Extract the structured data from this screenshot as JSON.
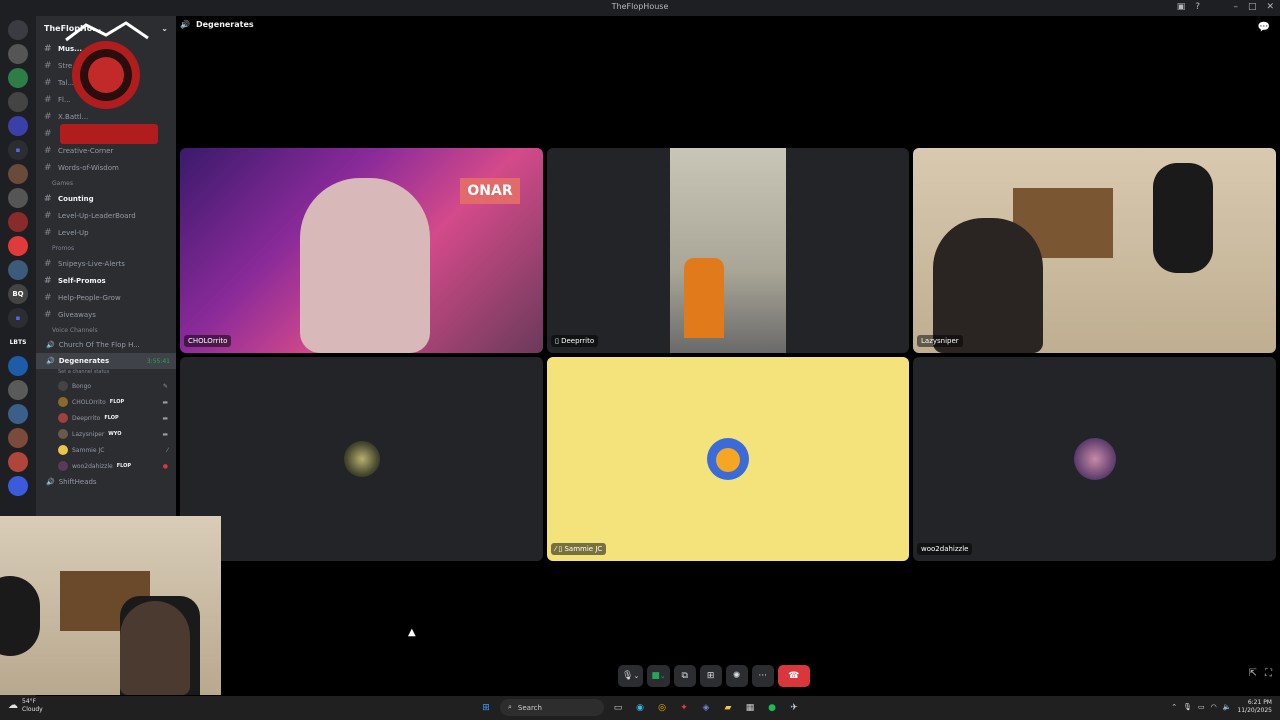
{
  "window": {
    "title": "TheFlopHouse"
  },
  "servers": [
    {
      "label": ""
    },
    {
      "label": ""
    },
    {
      "label": ""
    },
    {
      "label": ""
    },
    {
      "label": ""
    },
    {
      "label": ""
    },
    {
      "label": ""
    },
    {
      "label": ""
    },
    {
      "label": ""
    },
    {
      "label": ""
    },
    {
      "label": ""
    },
    {
      "label": "BQ"
    },
    {
      "label": ""
    },
    {
      "label": "LBTS"
    },
    {
      "label": ""
    },
    {
      "label": ""
    },
    {
      "label": ""
    },
    {
      "label": ""
    },
    {
      "label": ""
    },
    {
      "label": ""
    }
  ],
  "sidebar": {
    "guild_name": "TheFlopHo...",
    "channels_top": [
      {
        "label": "Mus..."
      },
      {
        "label": "Stre..."
      },
      {
        "label": "Tal..."
      },
      {
        "label": "Fl..."
      },
      {
        "label": "X.Battl..."
      },
      {
        "label": ""
      },
      {
        "label": "Creative-Corner"
      },
      {
        "label": "Words-of-Wisdom"
      }
    ],
    "cat_games": "Games",
    "channels_games": [
      {
        "label": "Counting",
        "bold": true
      },
      {
        "label": "Level-Up-LeaderBoard"
      },
      {
        "label": "Level-Up"
      }
    ],
    "cat_promos": "Promos",
    "channels_promos": [
      {
        "label": "Snipeys-Live-Alerts"
      },
      {
        "label": "Self-Promos",
        "bold": true
      },
      {
        "label": "Help-People-Grow"
      },
      {
        "label": "Giveaways"
      }
    ],
    "cat_voice": "Voice Channels",
    "voice_church": "Church Of The Flop H...",
    "voice_active": "Degenerates",
    "voice_timer": "3:55:41",
    "voice_status": "Set a channel status",
    "members": [
      {
        "name": "Bongo",
        "tag": ""
      },
      {
        "name": "CHOLOrrito",
        "tag": "FLOP"
      },
      {
        "name": "Deeprrito",
        "tag": "FLOP"
      },
      {
        "name": "Lazysniper",
        "tag": "WYO"
      },
      {
        "name": "Sammie JC",
        "tag": ""
      },
      {
        "name": "woo2dahizzle",
        "tag": "FLOP"
      }
    ],
    "voice_shift": "ShiftHeads"
  },
  "call": {
    "channel": "Degenerates",
    "tiles": [
      {
        "name": "CHOLOrrito"
      },
      {
        "name": "Deeprrito"
      },
      {
        "name": "Lazysniper"
      },
      {
        "name": ""
      },
      {
        "name": "Sammie JC"
      },
      {
        "name": "woo2dahizzle"
      }
    ]
  },
  "taskbar": {
    "weather_temp": "54°F",
    "weather_desc": "Cloudy",
    "search": "Search",
    "time": "6:21 PM",
    "date": "11/20/2025"
  },
  "colors": {
    "sammie_tile": "#f3e37a",
    "hangup": "#da373c",
    "accent": "#5865f2"
  }
}
